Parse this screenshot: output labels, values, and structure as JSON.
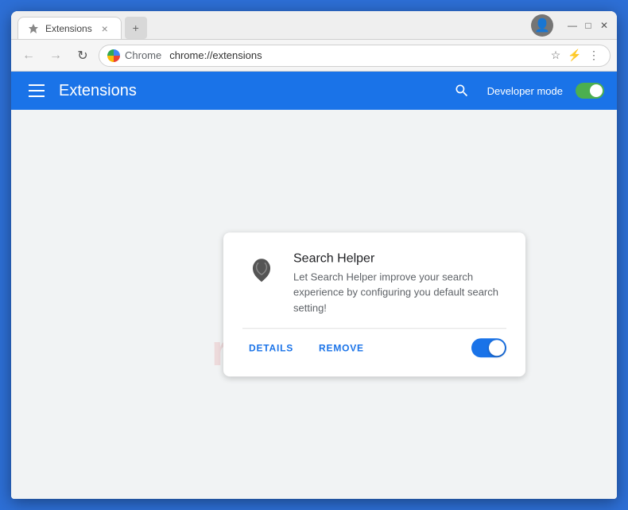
{
  "window": {
    "title": "Extensions",
    "tab_label": "Extensions",
    "close_label": "×"
  },
  "titlebar": {
    "profile_icon": "👤",
    "minimize": "—",
    "maximize": "□",
    "close": "✕"
  },
  "toolbar": {
    "back_disabled": true,
    "forward_disabled": true,
    "reload_label": "↻",
    "site_name": "Chrome",
    "url": "chrome://extensions",
    "bookmark_icon": "☆",
    "extensions_icon": "⚡",
    "menu_icon": "⋮"
  },
  "header": {
    "title": "Extensions",
    "search_tooltip": "Search extensions",
    "dev_mode_label": "Developer mode",
    "dev_mode_enabled": true
  },
  "extension": {
    "name": "Search Helper",
    "description": "Let Search Helper improve your search experience by configuring you default search setting!",
    "details_label": "DETAILS",
    "remove_label": "REMOVE",
    "enabled": true
  },
  "watermark": {
    "text": "risk.com"
  }
}
